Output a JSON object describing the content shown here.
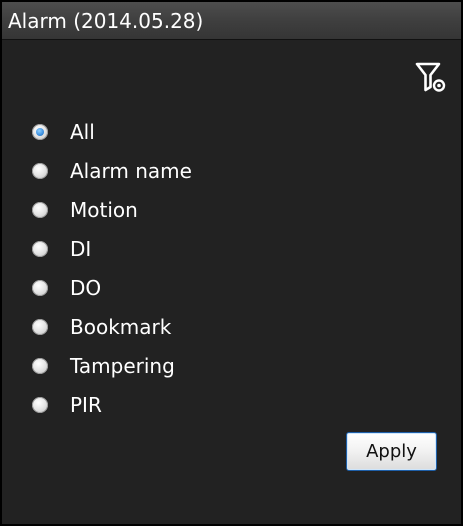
{
  "panel": {
    "title": "Alarm (2014.05.28)"
  },
  "filter_icon": "filter-settings-icon",
  "filter_options": [
    {
      "label": "All",
      "selected": true
    },
    {
      "label": "Alarm name",
      "selected": false
    },
    {
      "label": "Motion",
      "selected": false
    },
    {
      "label": "DI",
      "selected": false
    },
    {
      "label": "DO",
      "selected": false
    },
    {
      "label": "Bookmark",
      "selected": false
    },
    {
      "label": "Tampering",
      "selected": false
    },
    {
      "label": "PIR",
      "selected": false
    }
  ],
  "apply_label": "Apply",
  "colors": {
    "panel_background": "#222222",
    "title_bar": "#3f3f3f",
    "text": "#ffffff",
    "radio_selected": "#3a8ee0",
    "apply_border": "#1e5fa8"
  }
}
